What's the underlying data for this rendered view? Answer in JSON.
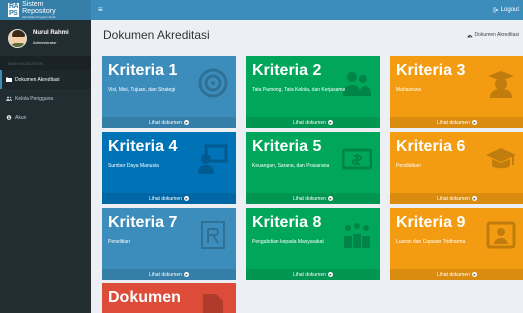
{
  "app": {
    "logo_mark_top": "RA",
    "logo_mark_bottom": "PS",
    "logo_line1": "Sistem",
    "logo_line2": "Repository",
    "logo_line3": "Akreditasi Program Studi"
  },
  "user": {
    "name": "Nurul Rahmi",
    "role": "Administrator"
  },
  "sidebar": {
    "header": "MAIN NAVIGATION",
    "items": [
      {
        "label": "Dokumen Akreditasi",
        "icon": "folder-icon",
        "active": true
      },
      {
        "label": "Kelola Pengguna",
        "icon": "users-icon",
        "active": false
      },
      {
        "label": "Akun",
        "icon": "user-circle-icon",
        "active": false
      }
    ]
  },
  "topbar": {
    "logout_label": "Logout"
  },
  "content": {
    "title": "Dokumen Akreditasi",
    "breadcrumb": "Dokumen Akreditasi"
  },
  "boxes": [
    {
      "title": "Kriteria 1",
      "desc": "Visi, Misi, Tujuan, dan Strategi",
      "link": "Lihat dokumen",
      "color": "#3c8dbc"
    },
    {
      "title": "Kriteria 2",
      "desc": "Tata Pamong, Tata Kelola, dan Kerjasama",
      "link": "Lihat dokumen",
      "color": "#00a65a"
    },
    {
      "title": "Kriteria 3",
      "desc": "Mahasiswa",
      "link": "Lihat dokumen",
      "color": "#f39c12"
    },
    {
      "title": "Kriteria 4",
      "desc": "Sumber Daya Manusia",
      "link": "Lihat dokumen",
      "color": "#0073b7"
    },
    {
      "title": "Kriteria 5",
      "desc": "Keuangan, Sarana, dan Prasarana",
      "link": "Lihat dokumen",
      "color": "#00a65a"
    },
    {
      "title": "Kriteria 6",
      "desc": "Pendidikan",
      "link": "Lihat dokumen",
      "color": "#f39c12"
    },
    {
      "title": "Kriteria 7",
      "desc": "Penelitian",
      "link": "Lihat dokumen",
      "color": "#3c8dbc"
    },
    {
      "title": "Kriteria 8",
      "desc": "Pengabdian kepada Masyarakat",
      "link": "Lihat dokumen",
      "color": "#00a65a"
    },
    {
      "title": "Kriteria 9",
      "desc": "Luaran dan Capaian Tridharma",
      "link": "Lihat dokumen",
      "color": "#f39c12"
    },
    {
      "title": "Dokumen",
      "desc": "",
      "link": "",
      "color": "#dd4b39"
    }
  ]
}
